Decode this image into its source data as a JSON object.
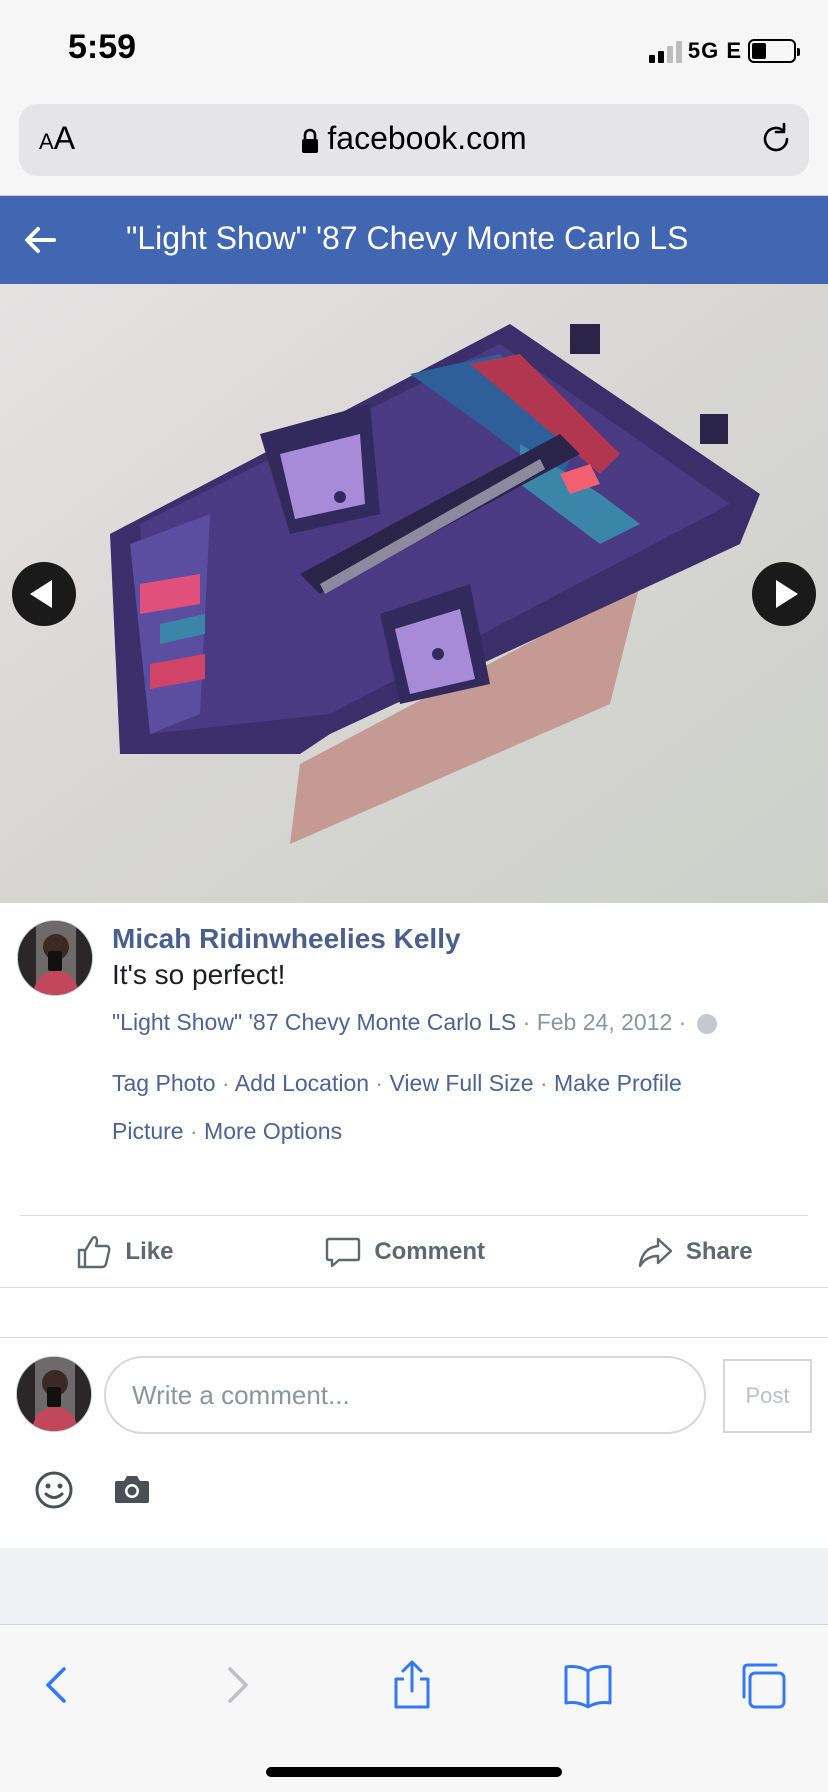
{
  "status_bar": {
    "time": "5:59",
    "network": "5G E"
  },
  "browser": {
    "text_size_label_small": "A",
    "text_size_label_large": "A",
    "url": "facebook.com"
  },
  "header": {
    "title": "\"Light Show\" '87 Chevy Monte Carlo LS"
  },
  "photo": {
    "alt": "Photo of a toy car interior with colorful fabric seats"
  },
  "post": {
    "author": "Micah Ridinwheelies Kelly",
    "caption": "It's so perfect!",
    "album_link": "\"Light Show\" '87 Chevy Monte Carlo LS",
    "separator": " · ",
    "date": "Feb 24, 2012",
    "action_links": [
      "Tag Photo",
      "Add Location",
      "View Full Size",
      "Make Profile Picture",
      "More Options"
    ]
  },
  "reactions": {
    "like": "Like",
    "comment": "Comment",
    "share": "Share"
  },
  "composer": {
    "placeholder": "Write a comment...",
    "post_label": "Post"
  },
  "colors": {
    "facebook_blue": "#4267b2",
    "link_blue": "#4b6395",
    "ios_blue": "#3478f6"
  }
}
